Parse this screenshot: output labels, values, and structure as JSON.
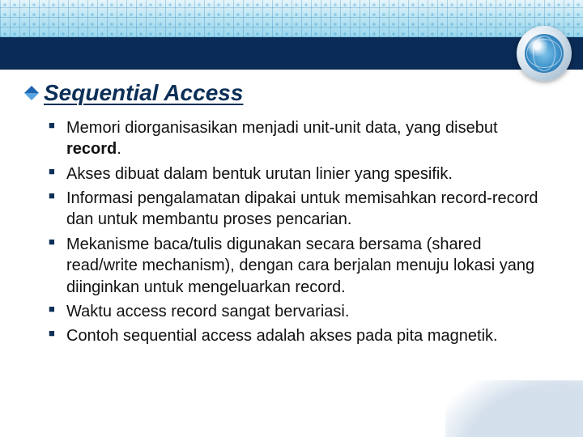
{
  "heading": "Sequential Access",
  "bullets": [
    {
      "pre": "Memori diorganisasikan menjadi unit-unit data, yang disebut ",
      "bold": "record",
      "post": "."
    },
    {
      "pre": "Akses dibuat dalam bentuk urutan linier yang spesifik.",
      "bold": "",
      "post": ""
    },
    {
      "pre": "Informasi pengalamatan dipakai untuk memisahkan record-record dan untuk membantu proses pencarian.",
      "bold": "",
      "post": ""
    },
    {
      "pre": "Mekanisme baca/tulis digunakan secara bersama (shared read/write mechanism), dengan cara berjalan menuju lokasi yang diinginkan untuk mengeluarkan record.",
      "bold": "",
      "post": ""
    },
    {
      "pre": "Waktu access record sangat bervariasi.",
      "bold": "",
      "post": ""
    },
    {
      "pre": "Contoh sequential access adalah akses pada pita magnetik.",
      "bold": "",
      "post": ""
    }
  ]
}
